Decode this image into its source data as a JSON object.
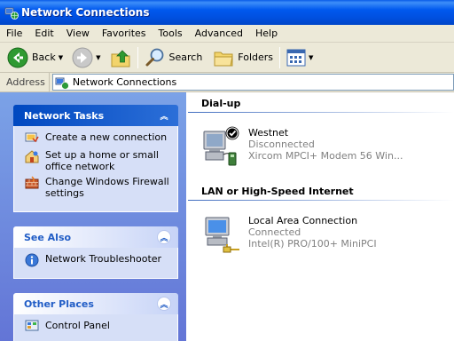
{
  "window": {
    "title": "Network Connections"
  },
  "menu": [
    "File",
    "Edit",
    "View",
    "Favorites",
    "Tools",
    "Advanced",
    "Help"
  ],
  "toolbar": {
    "back": "Back",
    "search": "Search",
    "folders": "Folders"
  },
  "address": {
    "label": "Address",
    "value": "Network Connections"
  },
  "left_panels": {
    "network_tasks": {
      "title": "Network Tasks",
      "items": [
        {
          "label": "Create a new connection",
          "icon": "new-connection-icon"
        },
        {
          "label": "Set up a home or small office network",
          "icon": "home-network-icon"
        },
        {
          "label": "Change Windows Firewall settings",
          "icon": "firewall-icon"
        }
      ]
    },
    "see_also": {
      "title": "See Also",
      "items": [
        {
          "label": "Network Troubleshooter",
          "icon": "info-icon"
        }
      ]
    },
    "other_places": {
      "title": "Other Places",
      "items": [
        {
          "label": "Control Panel",
          "icon": "control-panel-icon"
        }
      ]
    }
  },
  "groups": [
    {
      "title": "Dial-up",
      "items": [
        {
          "name": "Westnet",
          "status": "Disconnected",
          "device": "Xircom MPCI+ Modem 56 Win...",
          "icon": "dialup-connection-icon"
        }
      ]
    },
    {
      "title": "LAN or High-Speed Internet",
      "items": [
        {
          "name": "Local Area Connection",
          "status": "Connected",
          "device": "Intel(R) PRO/100+ MiniPCI",
          "icon": "lan-connection-icon"
        }
      ]
    }
  ],
  "colors": {
    "titlebar": "#0058ee",
    "taskpane": "#6375d6",
    "panel_body": "#d6dff7",
    "link": "#215dc6"
  }
}
